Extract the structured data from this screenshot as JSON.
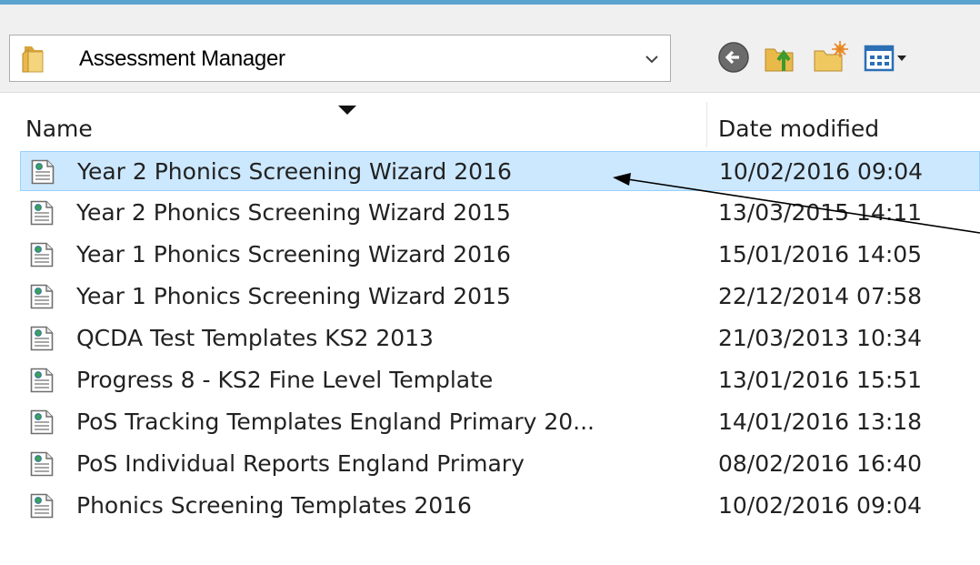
{
  "toolbar": {
    "look_in_value": "Assessment Manager",
    "icons": [
      "folder-icon",
      "back-icon",
      "up-folder-icon",
      "new-folder-icon",
      "view-menu-icon"
    ]
  },
  "columns": {
    "name": "Name",
    "date_modified": "Date modified"
  },
  "files": [
    {
      "name": "Year 2 Phonics Screening Wizard 2016",
      "date": "10/02/2016 09:04",
      "selected": true
    },
    {
      "name": "Year 2 Phonics Screening Wizard 2015",
      "date": "13/03/2015 14:11"
    },
    {
      "name": "Year 1 Phonics Screening Wizard 2016",
      "date": "15/01/2016 14:05"
    },
    {
      "name": "Year 1 Phonics Screening Wizard 2015",
      "date": "22/12/2014 07:58"
    },
    {
      "name": "QCDA Test Templates KS2 2013",
      "date": "21/03/2013 10:34"
    },
    {
      "name": "Progress 8 - KS2 Fine Level Template",
      "date": "13/01/2016 15:51"
    },
    {
      "name": "PoS Tracking Templates England Primary 20...",
      "date": "14/01/2016 13:18"
    },
    {
      "name": "PoS Individual Reports England Primary",
      "date": "08/02/2016 16:40"
    },
    {
      "name": "Phonics Screening Templates 2016",
      "date": "10/02/2016 09:04"
    }
  ],
  "colors": {
    "accent_border": "#5ba3cf",
    "selection_fill": "#cce8ff",
    "selection_border": "#99d1ff",
    "toolbar_bg": "#f0f0f0"
  }
}
